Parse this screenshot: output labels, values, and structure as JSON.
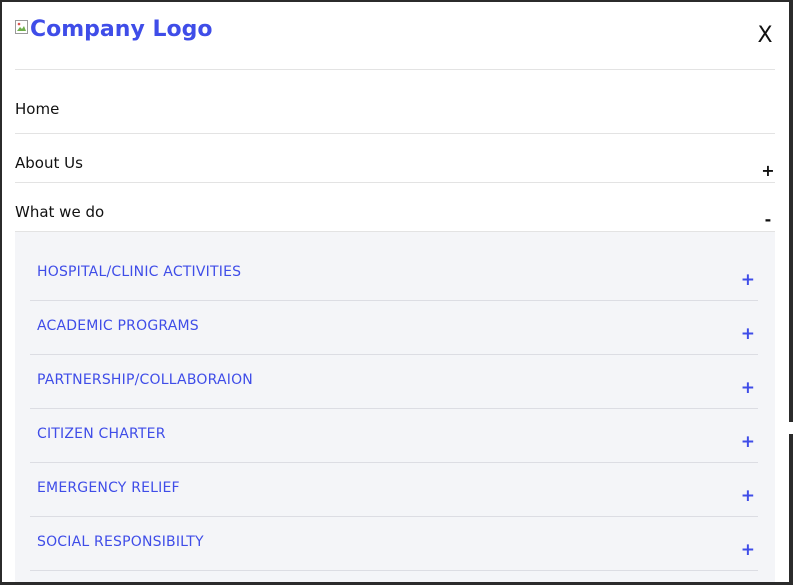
{
  "header": {
    "logo_alt": "Company Logo",
    "close_label": "X"
  },
  "nav": {
    "items": [
      {
        "label": "Home",
        "toggle": ""
      },
      {
        "label": "About Us",
        "toggle": "+"
      },
      {
        "label": "What we do",
        "toggle": "-"
      }
    ]
  },
  "submenu": {
    "items": [
      {
        "label": "HOSPITAL/CLINIC ACTIVITIES",
        "toggle": "+"
      },
      {
        "label": "ACADEMIC PROGRAMS",
        "toggle": "+"
      },
      {
        "label": "PARTNERSHIP/COLLABORAION",
        "toggle": "+"
      },
      {
        "label": "CITIZEN CHARTER",
        "toggle": "+"
      },
      {
        "label": "EMERGENCY RELIEF",
        "toggle": "+"
      },
      {
        "label": "SOCIAL RESPONSIBILTY",
        "toggle": "+"
      }
    ]
  },
  "colors": {
    "accent": "#3f4de8",
    "text": "#111111",
    "submenu_bg": "#f4f5f8",
    "divider": "#e3e3e3"
  },
  "icons": {
    "logo": "broken-image-icon",
    "close": "close-icon",
    "expand": "plus-icon",
    "collapse": "minus-icon"
  }
}
